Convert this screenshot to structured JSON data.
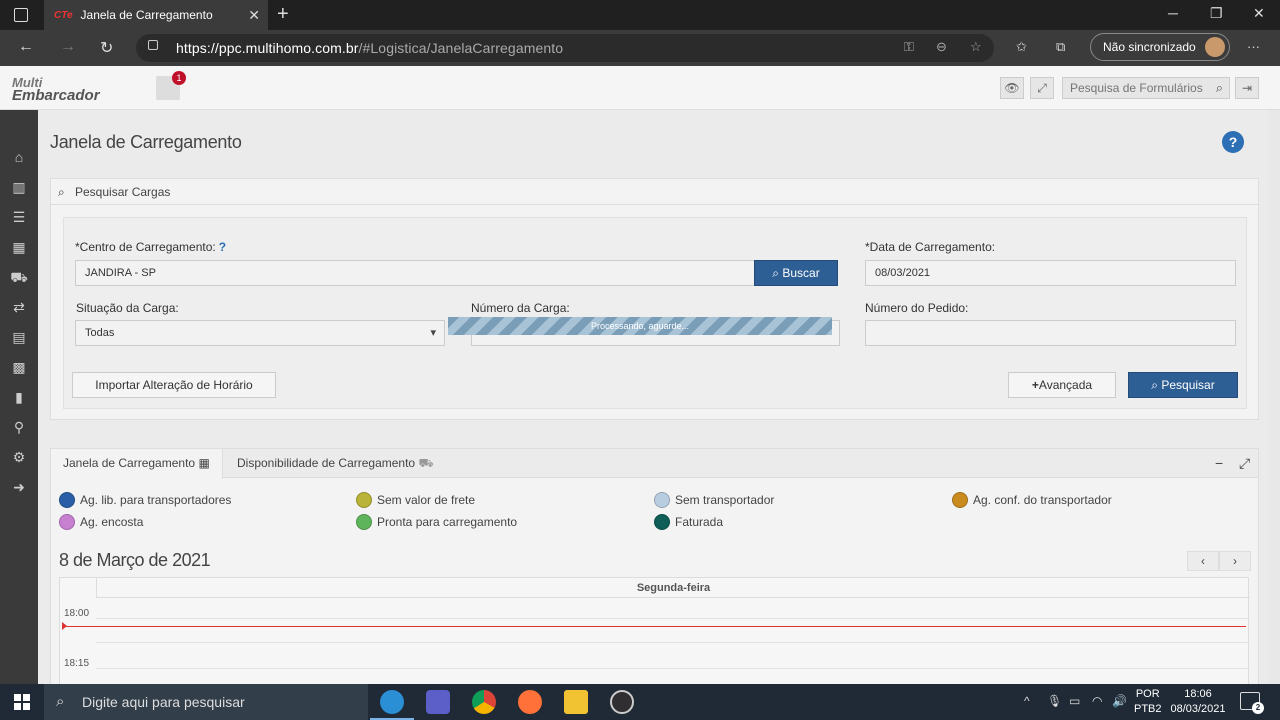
{
  "browser": {
    "tab_title": "Janela de Carregamento",
    "tab_favicon": "CTe",
    "url_host": "https://ppc.multihomo.com.br",
    "url_path": "/#Logistica/JanelaCarregamento",
    "sync_label": "Não sincronizado"
  },
  "app": {
    "logo_line1": "Multi",
    "logo_line2": "Embarcador",
    "notification_count": "1",
    "form_search_placeholder": "Pesquisa de Formulários"
  },
  "sidebar": {
    "icons": [
      "home-icon",
      "bar-chart-icon",
      "list-icon",
      "calendar-icon",
      "truck-icon",
      "exchange-icon",
      "table-icon",
      "grid-icon",
      "barcode-icon",
      "map-marker-icon",
      "gear-icon",
      "arrow-circle-right-icon"
    ]
  },
  "page": {
    "title": "Janela de Carregamento",
    "help": "?"
  },
  "search_panel": {
    "heading": "Pesquisar Cargas",
    "centro_label": "*Centro de Carregamento:",
    "centro_help": "?",
    "centro_value": "JANDIRA - SP",
    "buscar_label": "Buscar",
    "data_label": "*Data de Carregamento:",
    "data_value": "08/03/2021",
    "situacao_label": "Situação da Carga:",
    "situacao_value": "Todas",
    "numero_carga_label": "Número da Carga:",
    "numero_carga_value": "",
    "numero_pedido_label": "Número do Pedido:",
    "numero_pedido_value": "",
    "progress_text": "Processando, aguarde...",
    "importar_label": "Importar Alteração de Horário",
    "avancada_label": "Avançada",
    "pesquisar_label": "Pesquisar"
  },
  "calendar": {
    "tabs": [
      {
        "label": "Janela de Carregamento"
      },
      {
        "label": "Disponibilidade de Carregamento"
      }
    ],
    "legend": [
      {
        "label": "Ag. lib. para transportadores",
        "color": "#2a5fa8"
      },
      {
        "label": "Sem valor de frete",
        "color": "#b9b33a"
      },
      {
        "label": "Sem transportador",
        "color": "#b9cde0"
      },
      {
        "label": "Ag. conf. do transportador",
        "color": "#c98b1e"
      },
      {
        "label": "Ag. encosta",
        "color": "#c77fd0"
      },
      {
        "label": "Pronta para carregamento",
        "color": "#5eb45a"
      },
      {
        "label": "Faturada",
        "color": "#0f5e57"
      }
    ],
    "date_title": "8 de Março de 2021",
    "prev": "‹",
    "next": "›",
    "day_header": "Segunda-feira",
    "times": [
      "18:00",
      "18:15"
    ]
  },
  "taskbar": {
    "search_placeholder": "Digite aqui para pesquisar",
    "lang_line1": "POR",
    "lang_line2": "PTB2",
    "time": "18:06",
    "date": "08/03/2021",
    "notifications": "2"
  }
}
